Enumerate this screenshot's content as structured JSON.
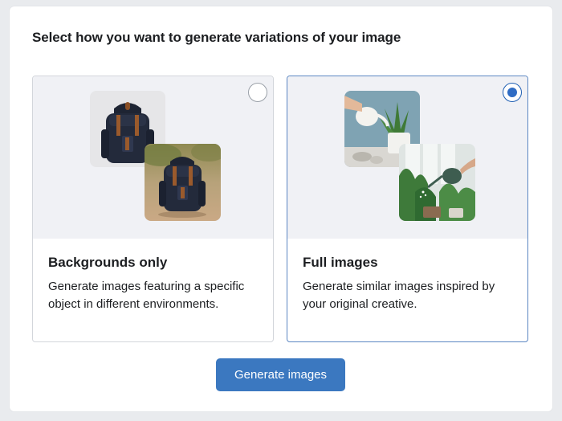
{
  "heading": "Select how you want to generate variations of your image",
  "options": [
    {
      "title": "Backgrounds only",
      "description": "Generate images featuring a specific object in different environments.",
      "selected": false
    },
    {
      "title": "Full images",
      "description": "Generate similar images inspired by your original creative.",
      "selected": true
    }
  ],
  "button_label": "Generate images",
  "colors": {
    "accent": "#3b78c0",
    "selected_border": "#5b86c2",
    "media_bg": "#f0f1f5"
  }
}
